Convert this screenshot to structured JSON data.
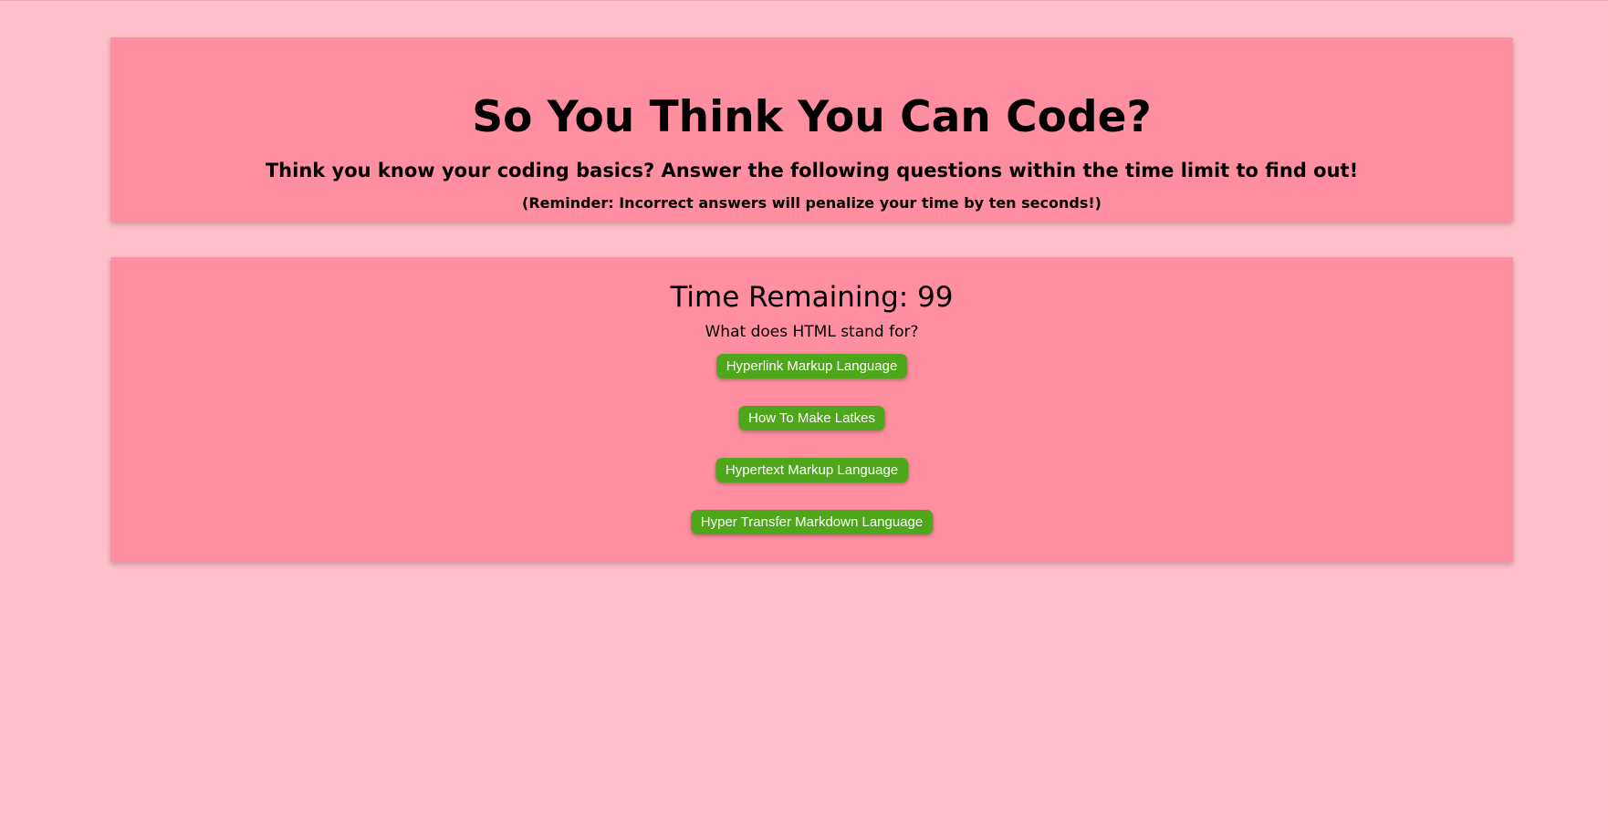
{
  "header": {
    "title": "So You Think You Can Code?",
    "subtitle": "Think you know your coding basics? Answer the following questions within the time limit to find out!",
    "reminder": "(Reminder: Incorrect answers will penalize your time by ten seconds!)"
  },
  "quiz": {
    "timer_label": "Time Remaining: 99",
    "question": "What does HTML stand for?",
    "answers": [
      "Hyperlink Markup Language",
      "How To Make Latkes",
      "Hypertext Markup Language",
      "Hyper Transfer Markdown Language"
    ]
  },
  "colors": {
    "background": "#ffc0cb",
    "panel": "#ff8fa0",
    "button": "#4ea61a",
    "button_text": "#ffffff"
  }
}
